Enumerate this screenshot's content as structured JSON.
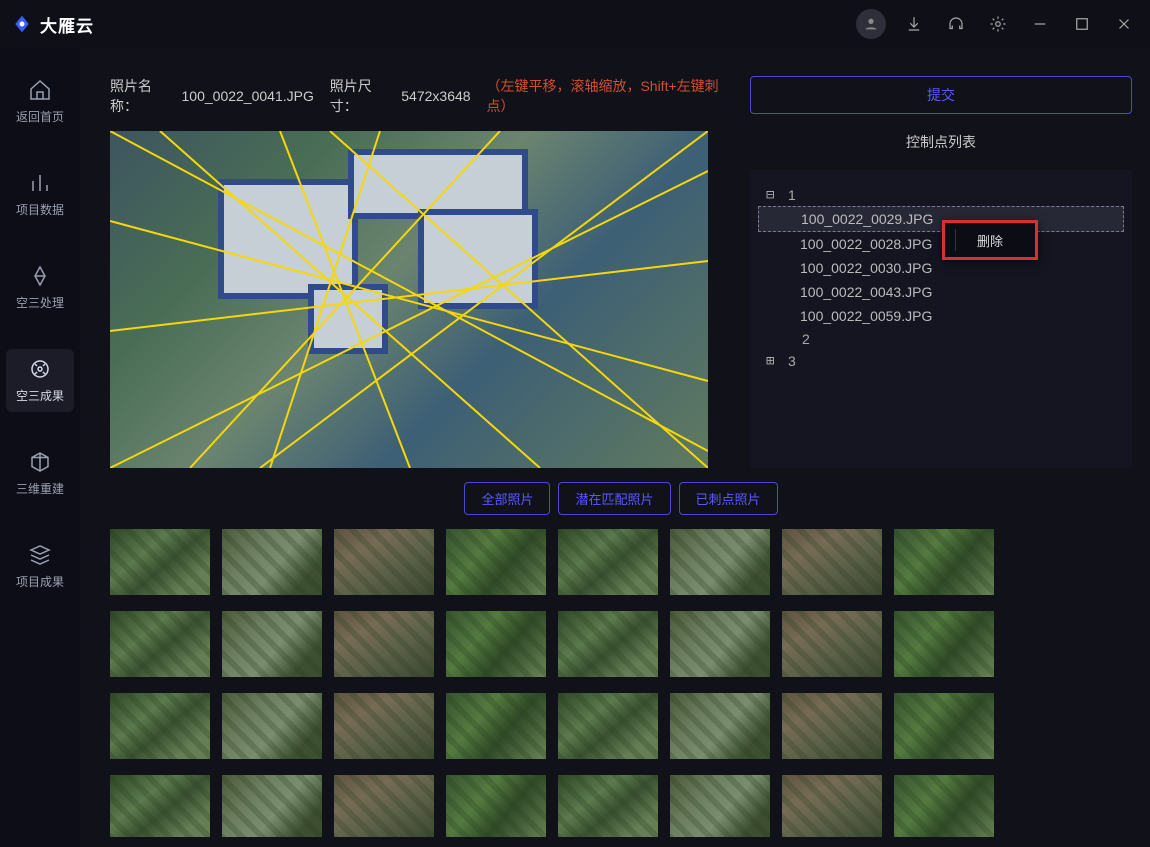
{
  "brand": {
    "text": "大雁云"
  },
  "sidebar": {
    "items": [
      {
        "label": "返回首页"
      },
      {
        "label": "项目数据"
      },
      {
        "label": "空三处理"
      },
      {
        "label": "空三成果"
      },
      {
        "label": "三维重建"
      },
      {
        "label": "项目成果"
      }
    ]
  },
  "info": {
    "name_label": "照片名称：",
    "name_value": "100_0022_0041.JPG",
    "dim_label": "照片尺寸：",
    "dim_value": "5472x3648",
    "hint": "（左键平移，滚轴缩放，Shift+左键刺点）"
  },
  "submit_label": "提交",
  "cp": {
    "title": "控制点列表",
    "groups": [
      {
        "id": "1",
        "expanded": true,
        "files": [
          "100_0022_0029.JPG",
          "100_0022_0028.JPG",
          "100_0022_0030.JPG",
          "100_0022_0043.JPG",
          "100_0022_0059.JPG"
        ]
      },
      {
        "id": "2",
        "expanded": false,
        "files": []
      },
      {
        "id": "3",
        "expanded": false,
        "files": []
      }
    ],
    "context_menu_label": "删除"
  },
  "tabs": [
    {
      "label": "全部照片"
    },
    {
      "label": "潜在匹配照片"
    },
    {
      "label": "已刺点照片"
    }
  ],
  "thumbnail_count": 32
}
